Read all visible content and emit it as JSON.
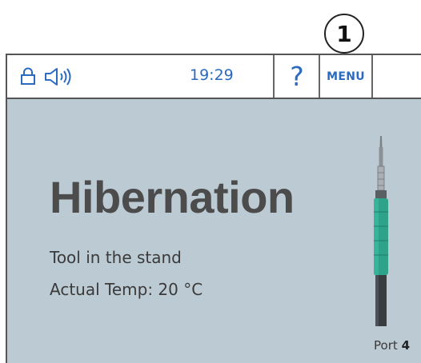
{
  "callout": {
    "number": "1"
  },
  "status_bar": {
    "time": "19:29",
    "help_label": "?",
    "menu_label": "MENU",
    "icons": [
      "lock-icon",
      "speaker-icon"
    ]
  },
  "main": {
    "title": "Hibernation",
    "status_line": "Tool in the stand",
    "temp_line": "Actual Temp: 20 °C"
  },
  "port": {
    "label": "Port",
    "number": "4"
  },
  "colors": {
    "accent": "#2a6abf",
    "screen_background": "#bccbd3",
    "tool_grip": "#2fa28b"
  }
}
